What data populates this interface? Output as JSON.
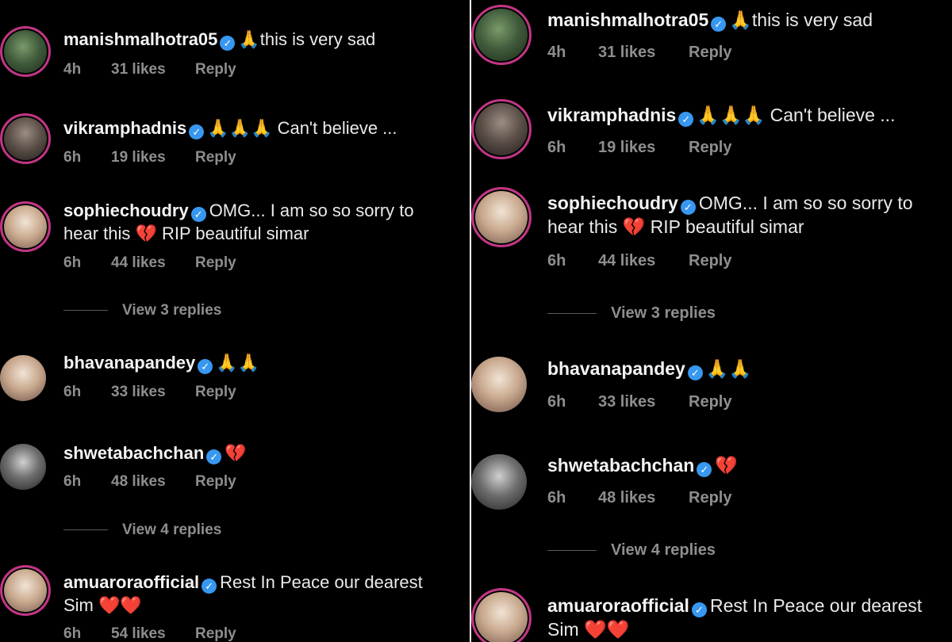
{
  "reply_label": "Reply",
  "verified_glyph": "✓",
  "icons": {
    "verified": "verified-badge-icon",
    "pray": "🙏",
    "broken_heart": "💔",
    "heart": "❤️"
  },
  "colors": {
    "background": "#000000",
    "verified": "#3897f0",
    "ring": "#c13584",
    "meta": "#8e8e8e"
  },
  "comments": [
    {
      "username": "manishmalhotra05",
      "text": "🙏this is very sad",
      "time": "4h",
      "likes": "31 likes",
      "reply": "Reply"
    },
    {
      "username": "vikramphadnis",
      "text": "🙏🙏🙏 Can't believe ...",
      "time": "6h",
      "likes": "19 likes",
      "reply": "Reply"
    },
    {
      "username": "sophiechoudry",
      "text": "OMG... I am so so sorry to",
      "text2": "hear this 💔 RIP beautiful simar",
      "time": "6h",
      "likes": "44 likes",
      "reply": "Reply",
      "view_replies": "View 3 replies"
    },
    {
      "username": "bhavanapandey",
      "text": "🙏🙏",
      "time": "6h",
      "likes": "33 likes",
      "reply": "Reply"
    },
    {
      "username": "shwetabachchan",
      "text": "💔",
      "time": "6h",
      "likes": "48 likes",
      "reply": "Reply",
      "view_replies": "View 4 replies"
    },
    {
      "username": "amuaroraofficial",
      "text": "Rest In Peace our dearest",
      "text2": "Sim ❤️❤️",
      "time": "6h",
      "likes": "54 likes",
      "reply": "Reply"
    }
  ]
}
